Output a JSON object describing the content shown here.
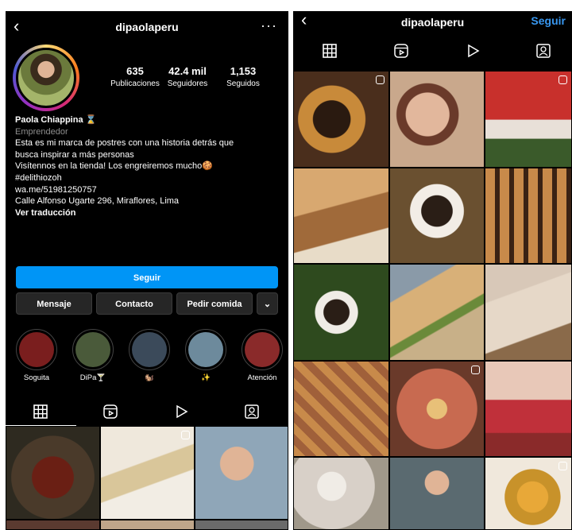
{
  "left": {
    "header": {
      "back_icon": "chevron-left-icon",
      "username": "dipaolaperu",
      "more_icon": "more-horizontal-icon"
    },
    "stats": [
      {
        "value": "635",
        "label": "Publicaciones"
      },
      {
        "value": "42.4 mil",
        "label": "Seguidores"
      },
      {
        "value": "1,153",
        "label": "Seguidos"
      }
    ],
    "bio": {
      "name": "Paola Chiappina ⌛",
      "category": "Emprendedor",
      "line1": "Esta es mi marca de postres con una historia detrás que",
      "line2": "busca inspirar a más personas",
      "line3": "Visítennos en la tienda! Los engreiremos mucho🍪",
      "line4": "#delithiozoh",
      "line5": "wa.me/51981250757",
      "line6": "Calle Alfonso Ugarte 296, Miraflores, Lima",
      "translate": "Ver traducción"
    },
    "buttons": {
      "follow": "Seguir",
      "message": "Mensaje",
      "contact": "Contacto",
      "order": "Pedir comida",
      "dropdown": "⌄"
    },
    "highlights": [
      {
        "label": "Soguita",
        "color": "#7a1e1e"
      },
      {
        "label": "DiPa🍸",
        "color": "#4a5a3a"
      },
      {
        "label": "🐿️",
        "color": "#3b4a5a"
      },
      {
        "label": "✨",
        "color": "#6d8a9c"
      },
      {
        "label": "Atención",
        "color": "#8a2a2a"
      }
    ],
    "grid_colors": [
      "#4a3a2a",
      "#d9cfc2",
      "#8fa6b8",
      "#5a3a30",
      "#bfa68a",
      "#6a6a6a"
    ]
  },
  "right": {
    "header": {
      "back_icon": "chevron-left-icon",
      "username": "dipaolaperu",
      "follow": "Seguir"
    },
    "grid_colors": [
      "#4a2e1c",
      "#c9a88c",
      "#c8302c",
      "#a06a3a",
      "#6a5030",
      "#8a5a2a",
      "#2e4a1e",
      "#c8b088",
      "#e6d8c8",
      "#a0603a",
      "#c86a50",
      "#c0303a",
      "#d8d0c8",
      "#5a6a70",
      "#c8922a"
    ]
  }
}
